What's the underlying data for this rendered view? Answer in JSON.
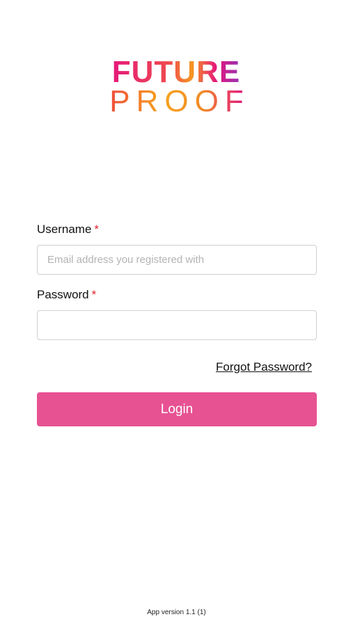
{
  "logo": {
    "line1": "FUTURE",
    "line2": "PROOF"
  },
  "form": {
    "username_label": "Username",
    "username_placeholder": "Email address you registered with",
    "username_value": "",
    "password_label": "Password",
    "password_value": "",
    "required_mark": "*",
    "forgot_label": "Forgot Password?",
    "login_label": "Login"
  },
  "footer": {
    "version": "App version 1.1 (1)"
  },
  "colors": {
    "login_button": "#e75293",
    "required_mark": "#e0242a",
    "logo_gradient": [
      "#e4157d",
      "#f0503a",
      "#f59a1e",
      "#e4157d",
      "#8a3ab9"
    ]
  }
}
